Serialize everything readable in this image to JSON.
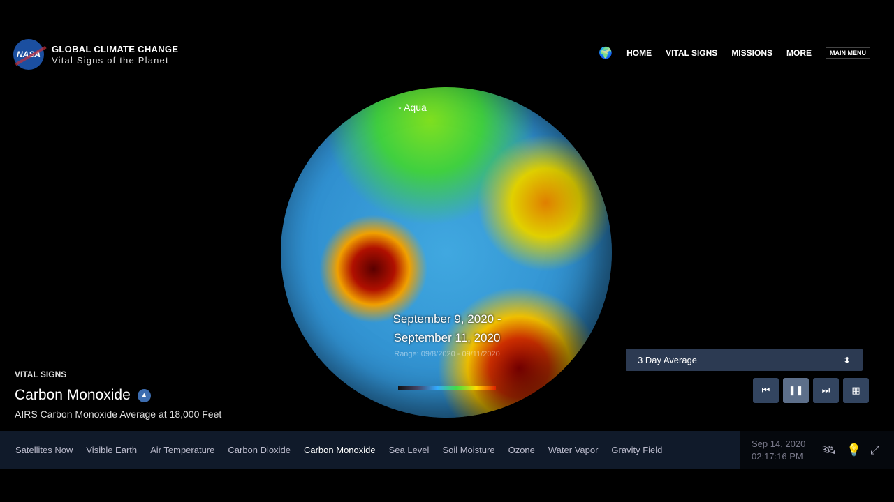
{
  "header": {
    "logo_text": "NASA",
    "title": "GLOBAL CLIMATE CHANGE",
    "subtitle": "Vital Signs of the Planet",
    "nav": [
      "HOME",
      "VITAL SIGNS",
      "MISSIONS",
      "MORE"
    ],
    "main_menu": "MAIN MENU"
  },
  "globe": {
    "satellite": "Aqua",
    "date_line1": "September 9, 2020 -",
    "date_line2": "September 11, 2020",
    "range": "Range: 09/8/2020 - 09/11/2020"
  },
  "panel": {
    "section": "VITAL SIGNS",
    "title": "Carbon Monoxide",
    "subtitle": "AIRS Carbon Monoxide Average at 18,000 Feet"
  },
  "controls": {
    "average": "3 Day Average",
    "icons": [
      "skip-back-icon",
      "pause-icon",
      "skip-forward-icon",
      "calendar-icon"
    ]
  },
  "bottom": {
    "items": [
      "Satellites Now",
      "Visible Earth",
      "Air Temperature",
      "Carbon Dioxide",
      "Carbon Monoxide",
      "Sea Level",
      "Soil Moisture",
      "Ozone",
      "Water Vapor",
      "Gravity Field"
    ],
    "active": "Carbon Monoxide",
    "date": "Sep 14, 2020",
    "time": "02:17:16 PM"
  }
}
